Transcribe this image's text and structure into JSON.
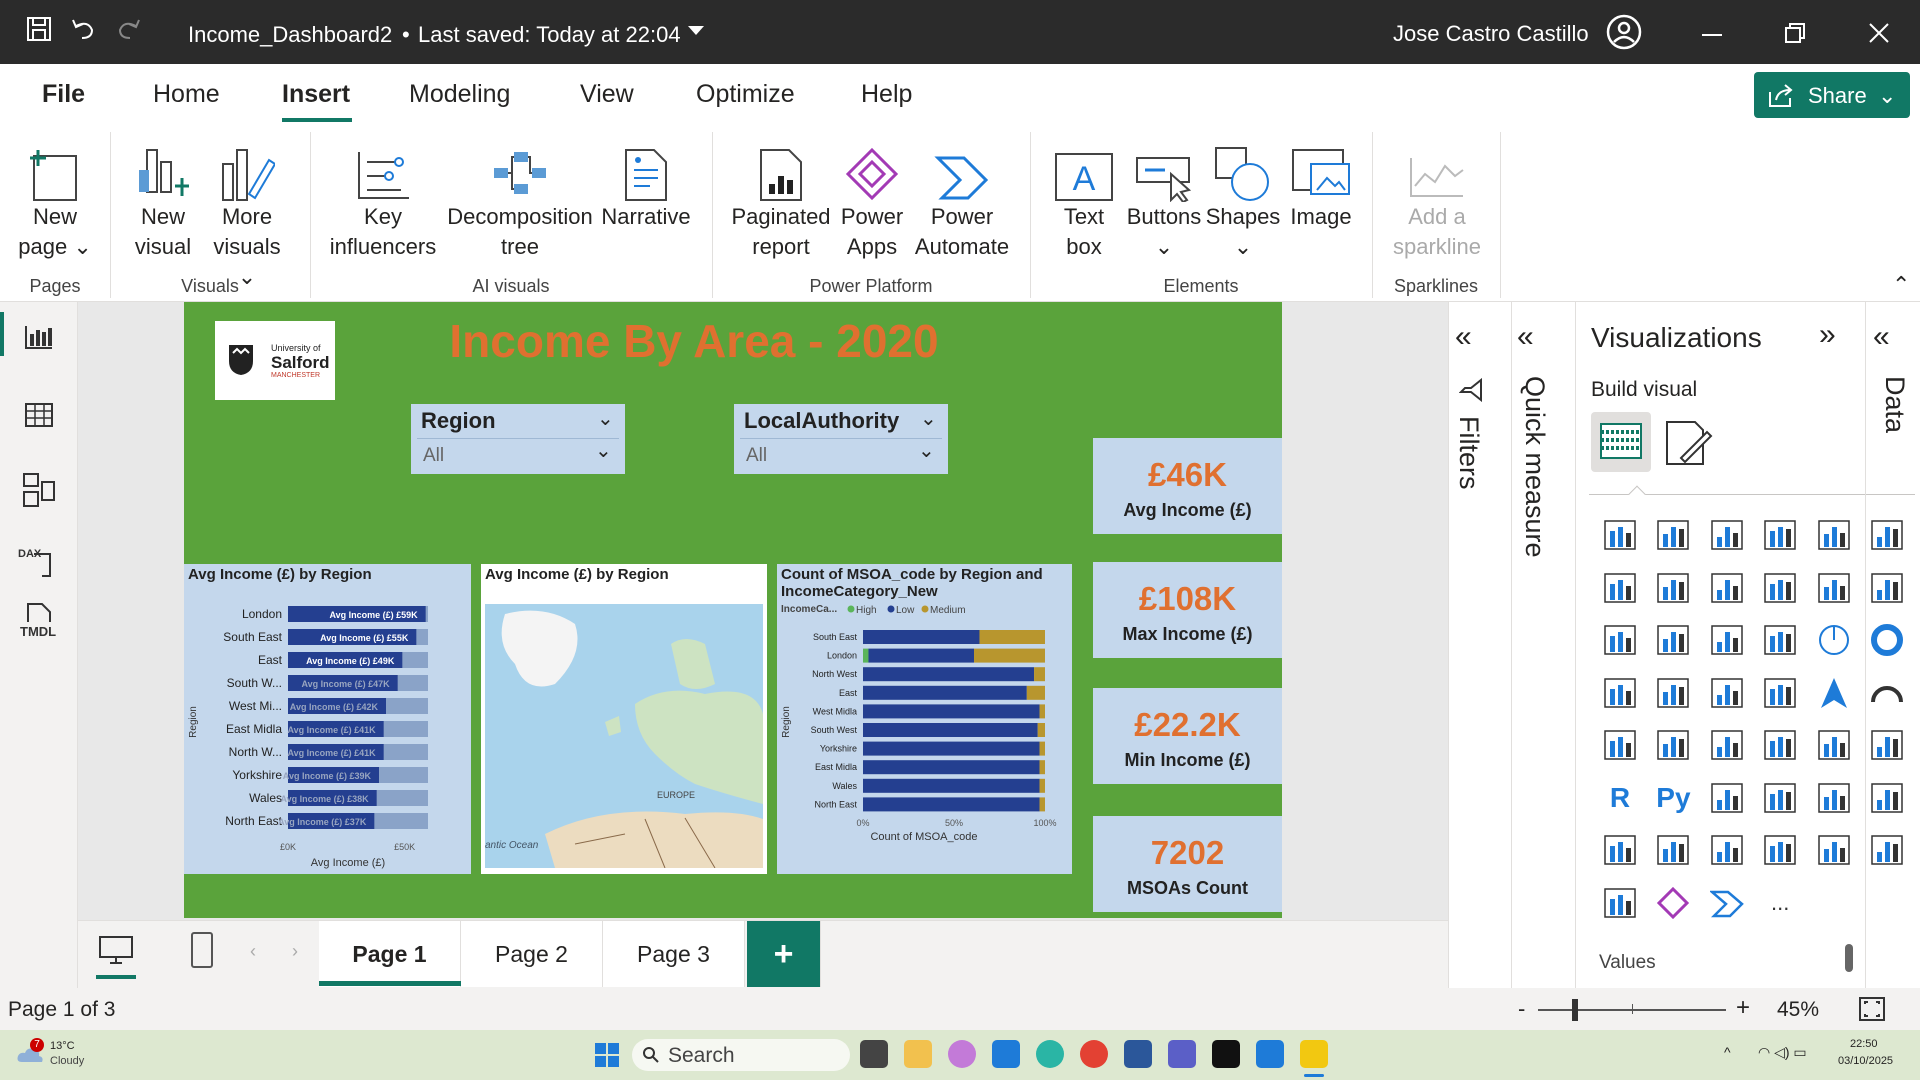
{
  "titlebar": {
    "title": "Income_Dashboard2",
    "saved": "Last saved: Today at 22:04",
    "user": "Jose Castro Castillo"
  },
  "menu": {
    "tabs": [
      "File",
      "Home",
      "Insert",
      "Modeling",
      "View",
      "Optimize",
      "Help"
    ],
    "active": "Insert",
    "share": "Share"
  },
  "ribbon": {
    "new_page": [
      "New",
      "page"
    ],
    "new_visual": [
      "New",
      "visual"
    ],
    "more_visuals": [
      "More",
      "visuals"
    ],
    "key_influencers": [
      "Key",
      "influencers"
    ],
    "decomposition": [
      "Decomposition",
      "tree"
    ],
    "narrative": "Narrative",
    "paginated": [
      "Paginated",
      "report"
    ],
    "power_apps": [
      "Power",
      "Apps"
    ],
    "power_automate": [
      "Power",
      "Automate"
    ],
    "text_box": [
      "Text",
      "box"
    ],
    "buttons": "Buttons",
    "shapes": "Shapes",
    "image": "Image",
    "sparkline": [
      "Add a",
      "sparkline"
    ],
    "groups": {
      "pages": "Pages",
      "visuals": "Visuals",
      "ai": "AI visuals",
      "platform": "Power Platform",
      "elements": "Elements",
      "sparklines": "Sparklines"
    }
  },
  "report": {
    "logo": {
      "line1": "University of",
      "line2": "Salford",
      "line3": "MANCHESTER"
    },
    "title": "Income By Area - 2020",
    "slicers": [
      {
        "label": "Region",
        "value": "All"
      },
      {
        "label": "LocalAuthority",
        "value": "All"
      }
    ],
    "cards": [
      {
        "value": "£46K",
        "label": "Avg Income (£)"
      },
      {
        "value": "£108K",
        "label": "Max Income (£)"
      },
      {
        "value": "£22.2K",
        "label": "Min Income (£)"
      },
      {
        "value": "7202",
        "label": "MSOAs Count"
      }
    ],
    "map": {
      "title": "Avg Income (£) by Region",
      "label_europe": "EUROPE",
      "label_ocean": "antic Ocean"
    },
    "colors": {
      "background": "#5aa33b",
      "card": "#c4d7ec",
      "value": "#e07030",
      "bar": "#243f90",
      "medium": "#b8962e"
    }
  },
  "chart_data": [
    {
      "type": "bar",
      "title": "Avg Income (£) by Region",
      "xlabel": "Avg Income (£)",
      "ylabel": "Region",
      "categories": [
        "London",
        "South East",
        "East",
        "South W...",
        "West Mi...",
        "East Midla",
        "North W...",
        "Yorkshire",
        "Wales",
        "North East"
      ],
      "values": [
        59,
        55,
        49,
        47,
        42,
        41,
        41,
        39,
        38,
        37
      ],
      "data_labels": [
        "£59K",
        "£55K",
        "£49K",
        "£47K",
        "£42K",
        "£41K",
        "£41K",
        "£39K",
        "£38K",
        "£37K"
      ],
      "bar_text": "Avg Income (£)",
      "xticks": [
        "£0K",
        "£50K"
      ],
      "xlim": [
        0,
        60
      ]
    },
    {
      "type": "bar",
      "title": "Count of MSOA_code by Region and IncomeCategory_New",
      "xlabel": "Count of MSOA_code",
      "ylabel": "Region",
      "legend_title": "IncomeCa...",
      "legend_position": "top",
      "categories": [
        "South East",
        "London",
        "North West",
        "East",
        "West Midla",
        "South West",
        "Yorkshire",
        "East Midla",
        "Wales",
        "North East"
      ],
      "series": [
        {
          "name": "High",
          "values": [
            0,
            3,
            0,
            0,
            0,
            0,
            0,
            0,
            0,
            0
          ]
        },
        {
          "name": "Low",
          "values": [
            64,
            58,
            94,
            90,
            97,
            96,
            97,
            97,
            97,
            97
          ]
        },
        {
          "name": "Medium",
          "values": [
            36,
            39,
            6,
            10,
            3,
            4,
            3,
            3,
            3,
            3
          ]
        }
      ],
      "xticks": [
        "0%",
        "50%",
        "100%"
      ],
      "series_colors": [
        "#5ab55a",
        "#243f90",
        "#b8962e"
      ]
    }
  ],
  "pages": {
    "tabs": [
      "Page 1",
      "Page 2",
      "Page 3"
    ],
    "active": "Page 1",
    "add": "+"
  },
  "panes": {
    "filters": "Filters",
    "quick_measure": "Quick measure",
    "visualizations": "Visualizations",
    "build_visual": "Build visual",
    "data": "Data",
    "values": "Values",
    "more": "..."
  },
  "status": {
    "page": "Page 1 of 3",
    "zoom": "45%",
    "zoom_minus": "-",
    "zoom_plus": "+"
  },
  "taskbar": {
    "temp": "13°C",
    "weather": "Cloudy",
    "badge": "7",
    "search": "Search",
    "time": "22:50",
    "date": "03/10/2025"
  }
}
